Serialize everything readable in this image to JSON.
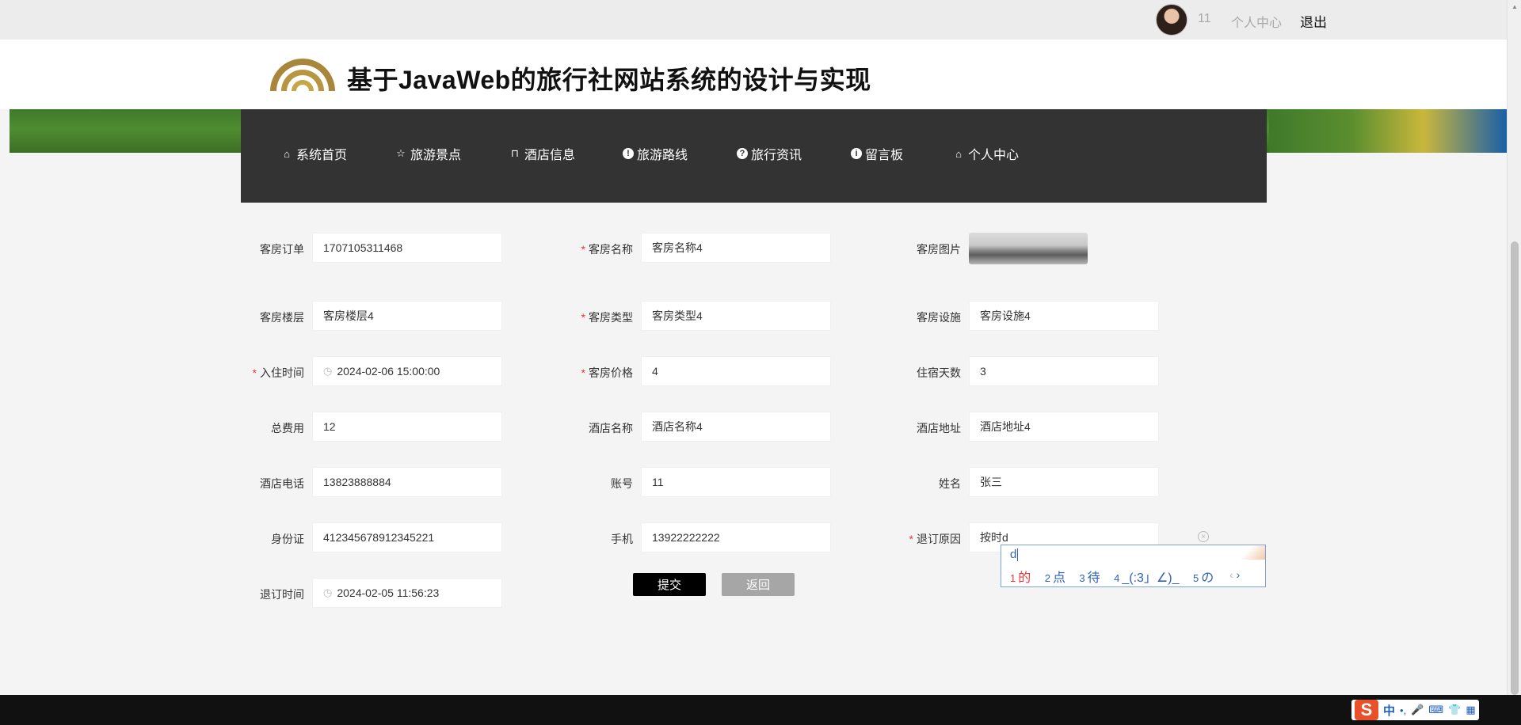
{
  "topbar": {
    "user": "11",
    "center_link": "个人中心",
    "logout": "退出"
  },
  "header": {
    "title": "基于JavaWeb的旅行社网站系统的设计与实现"
  },
  "nav": [
    {
      "label": "系统首页",
      "icon": "home-icon",
      "glyph": "⌂"
    },
    {
      "label": "旅游景点",
      "icon": "star-icon",
      "glyph": "☆"
    },
    {
      "label": "酒店信息",
      "icon": "bag-icon",
      "glyph": "⊓"
    },
    {
      "label": "旅游路线",
      "icon": "alert-circle-icon",
      "glyph": "!"
    },
    {
      "label": "旅行资讯",
      "icon": "question-circle-icon",
      "glyph": "?"
    },
    {
      "label": "留言板",
      "icon": "info-circle-icon",
      "glyph": "i"
    },
    {
      "label": "个人中心",
      "icon": "home-icon",
      "glyph": "⌂"
    }
  ],
  "form": {
    "order_no": {
      "label": "客房订单",
      "value": "1707105311468"
    },
    "room_name": {
      "label": "客房名称",
      "value": "客房名称4",
      "required": true
    },
    "room_image": {
      "label": "客房图片"
    },
    "floor": {
      "label": "客房楼层",
      "value": "客房楼层4"
    },
    "room_type": {
      "label": "客房类型",
      "value": "客房类型4",
      "required": true
    },
    "facilities": {
      "label": "客房设施",
      "value": "客房设施4"
    },
    "checkin": {
      "label": "入住时间",
      "value": "2024-02-06 15:00:00",
      "required": true
    },
    "price": {
      "label": "客房价格",
      "value": "4",
      "required": true
    },
    "days": {
      "label": "住宿天数",
      "value": "3"
    },
    "total": {
      "label": "总费用",
      "value": "12"
    },
    "hotel_name": {
      "label": "酒店名称",
      "value": "酒店名称4"
    },
    "hotel_addr": {
      "label": "酒店地址",
      "value": "酒店地址4"
    },
    "hotel_phone": {
      "label": "酒店电话",
      "value": "13823888884"
    },
    "account": {
      "label": "账号",
      "value": "11"
    },
    "name": {
      "label": "姓名",
      "value": "张三"
    },
    "id_card": {
      "label": "身份证",
      "value": "412345678912345221"
    },
    "mobile": {
      "label": "手机",
      "value": "13922222222"
    },
    "cancel_reason": {
      "label": "退订原因",
      "value": "按时d",
      "required": true
    },
    "cancel_time": {
      "label": "退订时间",
      "value": "2024-02-05 11:56:23"
    }
  },
  "buttons": {
    "submit": "提交",
    "back": "返回"
  },
  "ime": {
    "composition": "d",
    "candidates": [
      {
        "num": "1",
        "text": "的"
      },
      {
        "num": "2",
        "text": "点"
      },
      {
        "num": "3",
        "text": "待"
      },
      {
        "num": "4",
        "text": "_(:3」∠)_"
      },
      {
        "num": "5",
        "text": "の"
      }
    ],
    "prev": "‹",
    "next": "›"
  },
  "tray": {
    "logo": "S",
    "lang": "中",
    "punct": "•,",
    "mic": "🎤",
    "kbd": "⌨",
    "skin": "👕",
    "grid": "▦"
  }
}
